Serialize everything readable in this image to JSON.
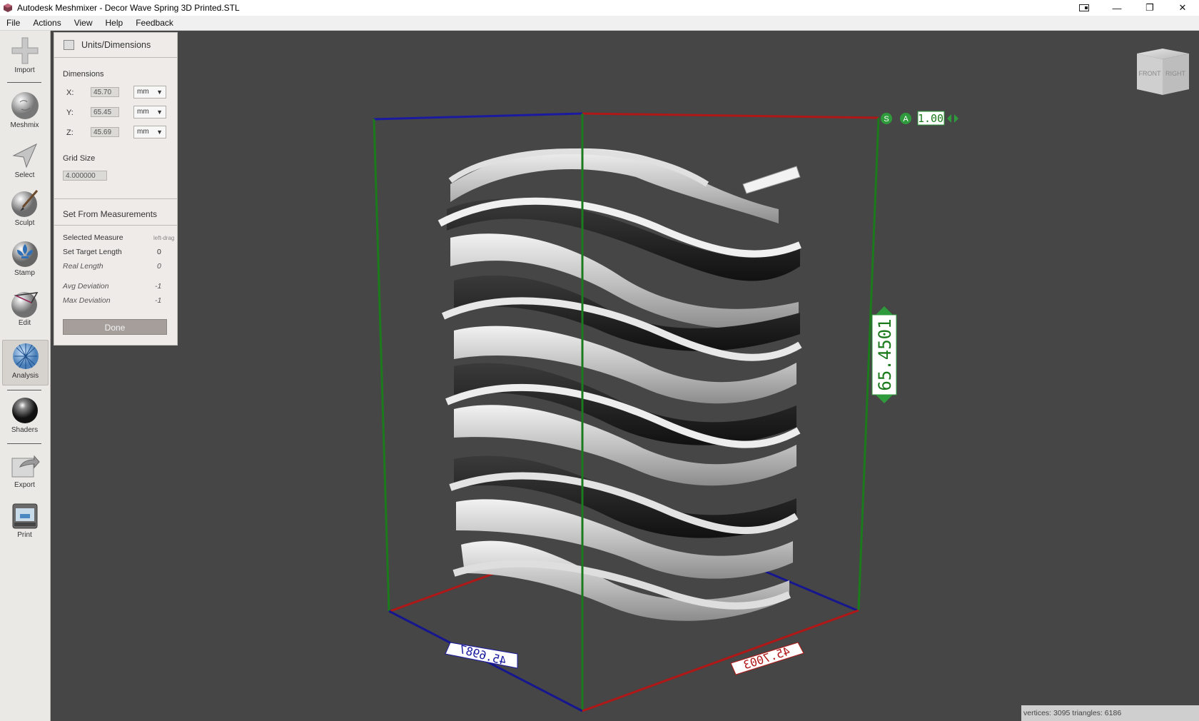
{
  "window": {
    "title": "Autodesk Meshmixer - Decor Wave Spring 3D Printed.STL",
    "controls": {
      "minimize": "—",
      "restore": "❐",
      "close": "✕"
    }
  },
  "menu": [
    "File",
    "Actions",
    "View",
    "Help",
    "Feedback"
  ],
  "toolbar": [
    {
      "label": "Import",
      "icon": "plus-icon"
    },
    {
      "label": "Meshmix",
      "icon": "meshmix-bunny-icon"
    },
    {
      "label": "Select",
      "icon": "select-arrow-icon"
    },
    {
      "label": "Sculpt",
      "icon": "sculpt-brush-icon"
    },
    {
      "label": "Stamp",
      "icon": "stamp-fleur-icon"
    },
    {
      "label": "Edit",
      "icon": "edit-sphere-icon"
    },
    {
      "label": "Analysis",
      "icon": "analysis-mesh-icon",
      "active": true
    },
    {
      "label": "Shaders",
      "icon": "shader-sphere-icon"
    },
    {
      "label": "Export",
      "icon": "export-icon"
    },
    {
      "label": "Print",
      "icon": "printer-icon"
    }
  ],
  "panel": {
    "title": "Units/Dimensions",
    "dimensions_label": "Dimensions",
    "x_label": "X:",
    "x_value": "45.70",
    "x_unit": "mm",
    "y_label": "Y:",
    "y_value": "65.45",
    "y_unit": "mm",
    "z_label": "Z:",
    "z_value": "45.69",
    "z_unit": "mm",
    "grid_label": "Grid Size",
    "grid_value": "4.000000",
    "measure_section": "Set From Measurements",
    "selected_measure": "Selected Measure",
    "selected_measure_value": "left-drag",
    "target_length": "Set Target Length",
    "target_length_value": "0",
    "real_length": "Real Length",
    "real_length_value": "0",
    "avg_dev": "Avg Deviation",
    "avg_dev_value": "-1",
    "max_dev": "Max Deviation",
    "max_dev_value": "-1",
    "done": "Done"
  },
  "viewport": {
    "height_readout": "65.4501",
    "x_readout": "45.6987",
    "z_readout": "45.7003",
    "scale_value": "1.00",
    "s_button": "S",
    "a_button": "A",
    "cube_front": "FRONT",
    "cube_right": "RIGHT"
  },
  "status": "vertices: 3095 triangles: 6186",
  "colors": {
    "axis_x": "#c01818",
    "axis_y": "#1c7a1c",
    "axis_z": "#12129a",
    "viewport_bg": "#464646"
  }
}
